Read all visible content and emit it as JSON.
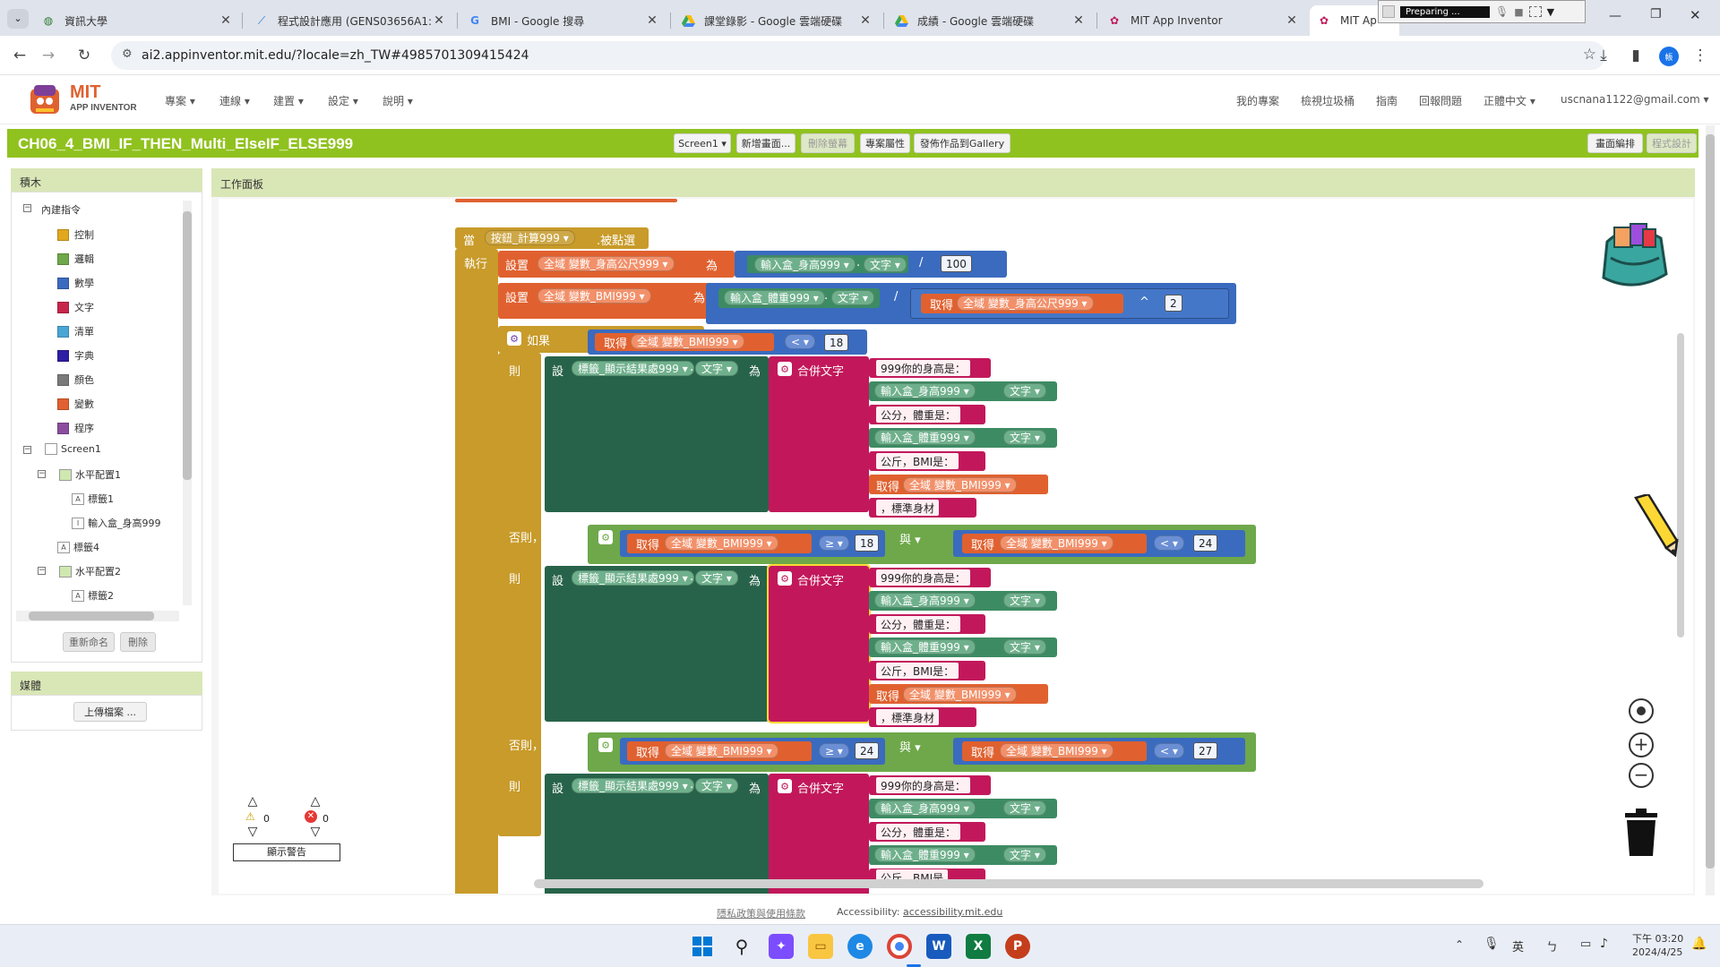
{
  "browser": {
    "tabs": [
      {
        "title": "資訊大學",
        "icon": "globe-icon"
      },
      {
        "title": "程式設計應用 (GENS03656A1:",
        "icon": "app-icon"
      },
      {
        "title": "BMI - Google 搜尋",
        "icon": "google-icon"
      },
      {
        "title": "課堂錄影 - Google 雲端硬碟",
        "icon": "drive-icon"
      },
      {
        "title": "成績 - Google 雲端硬碟",
        "icon": "drive-icon"
      },
      {
        "title": "MIT App Inventor",
        "icon": "appinventor-icon"
      },
      {
        "title": "MIT Ap",
        "icon": "appinventor-icon"
      }
    ],
    "recording_label": "Preparing ...",
    "url": "ai2.appinventor.mit.edu/?locale=zh_TW#4985701309415424",
    "profile": "帳"
  },
  "app": {
    "logo_title": "MIT",
    "logo_sub": "APP INVENTOR",
    "menus": [
      "專案 ▾",
      "連線 ▾",
      "建置 ▾",
      "設定 ▾",
      "說明 ▾"
    ],
    "right_menus": [
      "我的專案",
      "檢視垃圾桶",
      "指南",
      "回報問題",
      "正體中文 ▾"
    ],
    "user": "uscnana1122@gmail.com ▾",
    "project_name": "CH06_4_BMI_IF_THEN_Multi_ElseIF_ELSE999",
    "screen_btn": "Screen1 ▾",
    "add_screen": "新增畫面...",
    "remove_screen": "刪除螢幕",
    "project_props": "專案屬性",
    "publish": "發佈作品到Gallery",
    "designer": "畫面編排",
    "blocks": "程式設計"
  },
  "palette": {
    "title": "積木",
    "builtin": "內建指令",
    "builtins": [
      {
        "label": "控制",
        "color": "#e1a81e"
      },
      {
        "label": "邏輯",
        "color": "#6ea84a"
      },
      {
        "label": "數學",
        "color": "#3a6bbf"
      },
      {
        "label": "文字",
        "color": "#c7264b"
      },
      {
        "label": "清單",
        "color": "#49a6d4"
      },
      {
        "label": "字典",
        "color": "#2d1ea3"
      },
      {
        "label": "顏色",
        "color": "#7a7a7a"
      },
      {
        "label": "變數",
        "color": "#e0612f"
      },
      {
        "label": "程序",
        "color": "#8b4c9e"
      }
    ],
    "components": [
      "Screen1",
      "水平配置1",
      "標籤1",
      "輸入盒_身高999",
      "標籤4",
      "水平配置2",
      "標籤2"
    ],
    "rename": "重新命名",
    "delete": "刪除",
    "media_title": "媒體",
    "upload": "上傳檔案 ..."
  },
  "workspace": {
    "title": "工作面板",
    "warn_count": "0",
    "error_count": "0",
    "show_warnings": "顯示警告"
  },
  "blocks": {
    "when": "當",
    "button": "按鈕_計算999 ▾",
    "clicked": ".被點選",
    "do": "執行",
    "set": "設置",
    "global_height": "全域 變數_身高公尺999 ▾",
    "to": "為",
    "textbox_height": "輸入盒_身高999 ▾",
    "text_prop": "文字 ▾",
    "div": "/",
    "hundred": "100",
    "global_bmi": "全域 變數_BMI999 ▾",
    "textbox_weight": "輸入盒_體重999 ▾",
    "get": "取得",
    "pow": "^",
    "two": "2",
    "if": "如果",
    "lt": "< ▾",
    "gte": "≥ ▾",
    "eighteen": "18",
    "twentyfour": "24",
    "twentyseven": "27",
    "then": "則",
    "set_short": "設",
    "label_result": "標籤_顯示結果處999 ▾",
    "join": "合併文字",
    "s1": "999你的身高是：",
    "s2": "公分，體重是：",
    "s3": "公斤，BMI是：",
    "s4": "，標準身材",
    "s5": "公斤，BMI是",
    "elseif": "否則，如果",
    "and": "與 ▾",
    "dot": "."
  },
  "footer": {
    "privacy": "隱私政策與使用條款",
    "access_label": "Accessibility:",
    "access_link": "accessibility.mit.edu"
  },
  "taskbar": {
    "lang": "英",
    "time": "下午 03:20",
    "date": "2024/4/25"
  }
}
